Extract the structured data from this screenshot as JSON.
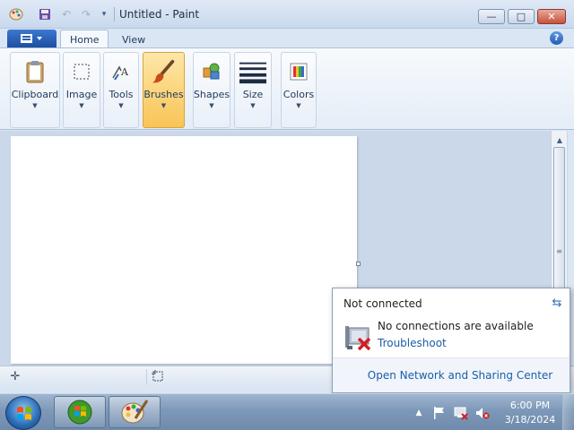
{
  "window": {
    "title": "Untitled - Paint",
    "minimize_glyph": "—",
    "maximize_glyph": "□",
    "close_glyph": "✕"
  },
  "tabs": [
    {
      "label": "Home",
      "active": true
    },
    {
      "label": "View",
      "active": false
    }
  ],
  "ribbon_groups": [
    {
      "label": "Clipboard",
      "icon": "clipboard-icon"
    },
    {
      "label": "Image",
      "icon": "select-icon"
    },
    {
      "label": "Tools",
      "icon": "tools-icon"
    },
    {
      "label": "Brushes",
      "icon": "brush-icon",
      "highlighted": true
    },
    {
      "label": "Shapes",
      "icon": "shapes-icon"
    },
    {
      "label": "Size",
      "icon": "size-lines-icon"
    },
    {
      "label": "Colors",
      "icon": "color-palette-icon"
    }
  ],
  "network_flyout": {
    "title": "Not connected",
    "message": "No connections are available",
    "troubleshoot_link": "Troubleshoot",
    "footer_link": "Open Network and Sharing Center"
  },
  "clock": {
    "time": "6:00 PM",
    "date": "3/18/2024"
  },
  "colors": {
    "accent": "#1c4fa3",
    "highlight": "#f9c456",
    "link": "#1a5ea8"
  }
}
